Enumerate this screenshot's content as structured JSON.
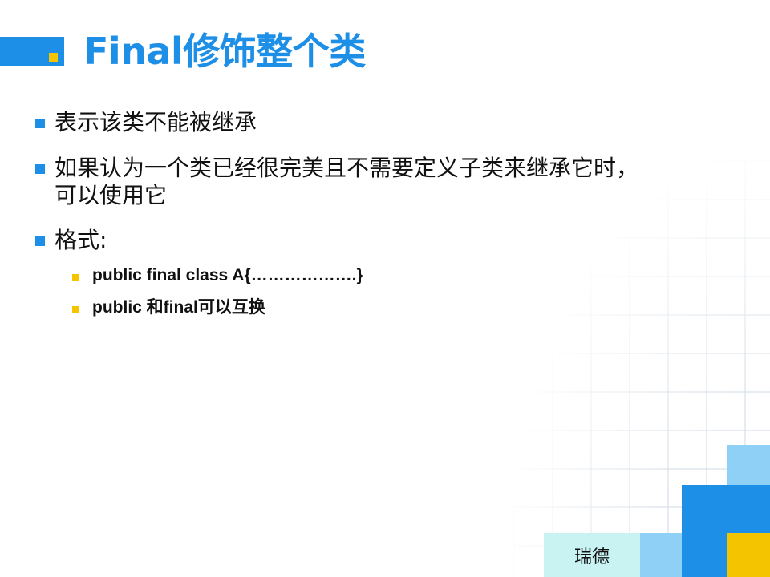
{
  "title": "Final修饰整个类",
  "bullets": [
    {
      "text": "表示该类不能被继承"
    },
    {
      "line1": "如果认为一个类已经很完美且不需要定义子类来继承它时，",
      "line2": "可以使用它"
    },
    {
      "text": "格式:"
    }
  ],
  "sub_bullets": [
    {
      "text": "public final class A{……………….}"
    },
    {
      "text": "public 和final可以互换"
    }
  ],
  "footer": {
    "label": "瑞德"
  },
  "colors": {
    "accent_blue": "#1e8fe6",
    "accent_yellow": "#f5c400",
    "light_blue": "#8fd0f7",
    "cyan_pale": "#c9f3f3"
  }
}
